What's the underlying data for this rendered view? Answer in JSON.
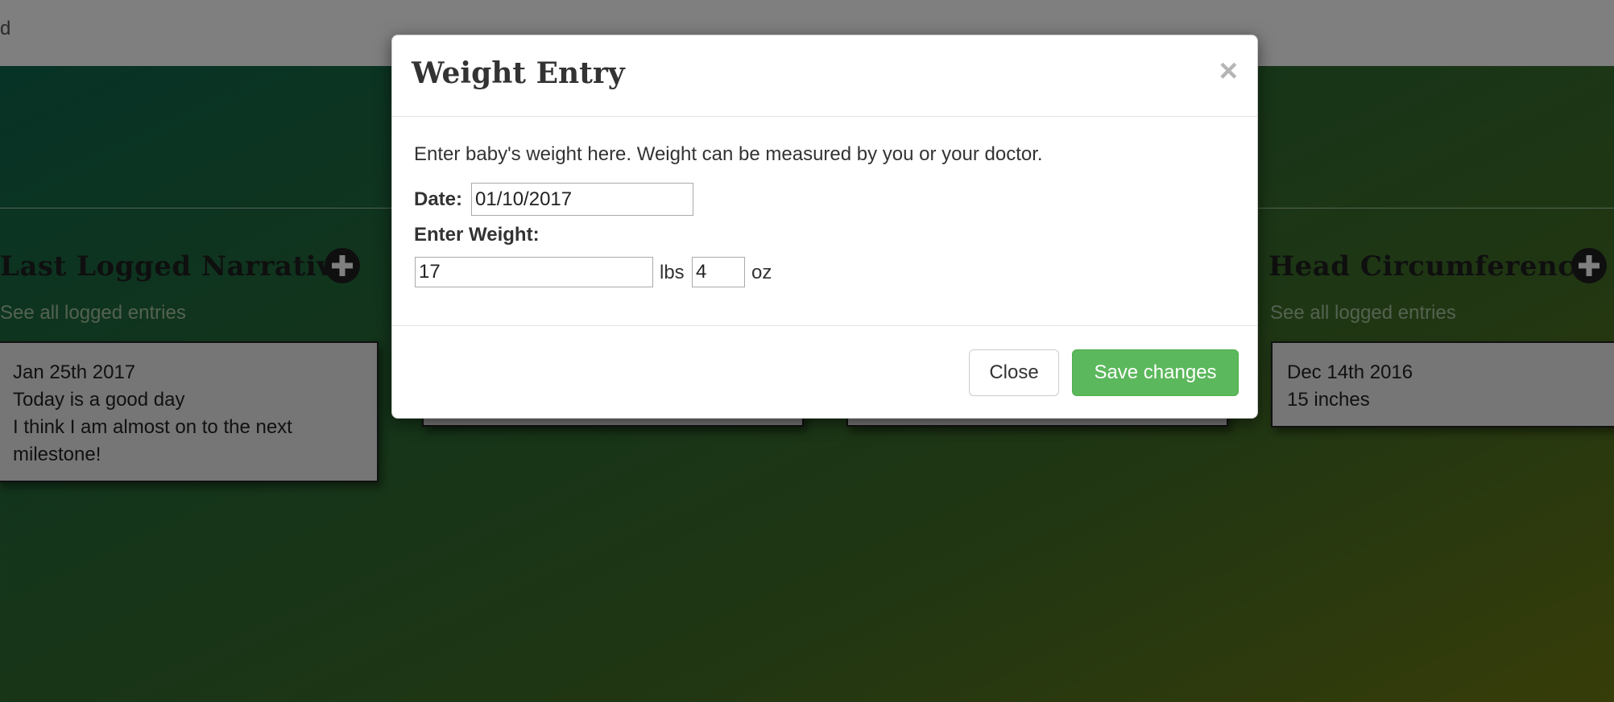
{
  "nav": {
    "partial_text": "d"
  },
  "sections": {
    "narrative": {
      "title": "Last Logged Narrative",
      "see_all": "See all logged entries",
      "entry_date": "Jan 25th 2017",
      "entry_line1": "Today is a good day",
      "entry_line2": "I think I am almost on to the next",
      "entry_line3": "milestone!"
    },
    "head": {
      "title": "Head Circumference",
      "see_all": "See all logged entries",
      "entry_date": "Dec 14th 2016",
      "entry_value": "15 inches"
    }
  },
  "modal": {
    "title": "Weight Entry",
    "close_symbol": "×",
    "description": "Enter baby's weight here. Weight can be measured by you or your doctor.",
    "date_label": "Date:",
    "date_value": "01/10/2017",
    "weight_label": "Enter Weight:",
    "lbs_value": "17",
    "lbs_unit": "lbs",
    "oz_value": "4",
    "oz_unit": "oz",
    "close_button": "Close",
    "save_button": "Save changes"
  },
  "colors": {
    "save_button": "#5cb85c",
    "backdrop": "rgba(0,0,0,0.5)",
    "link": "#a9c4a0"
  }
}
